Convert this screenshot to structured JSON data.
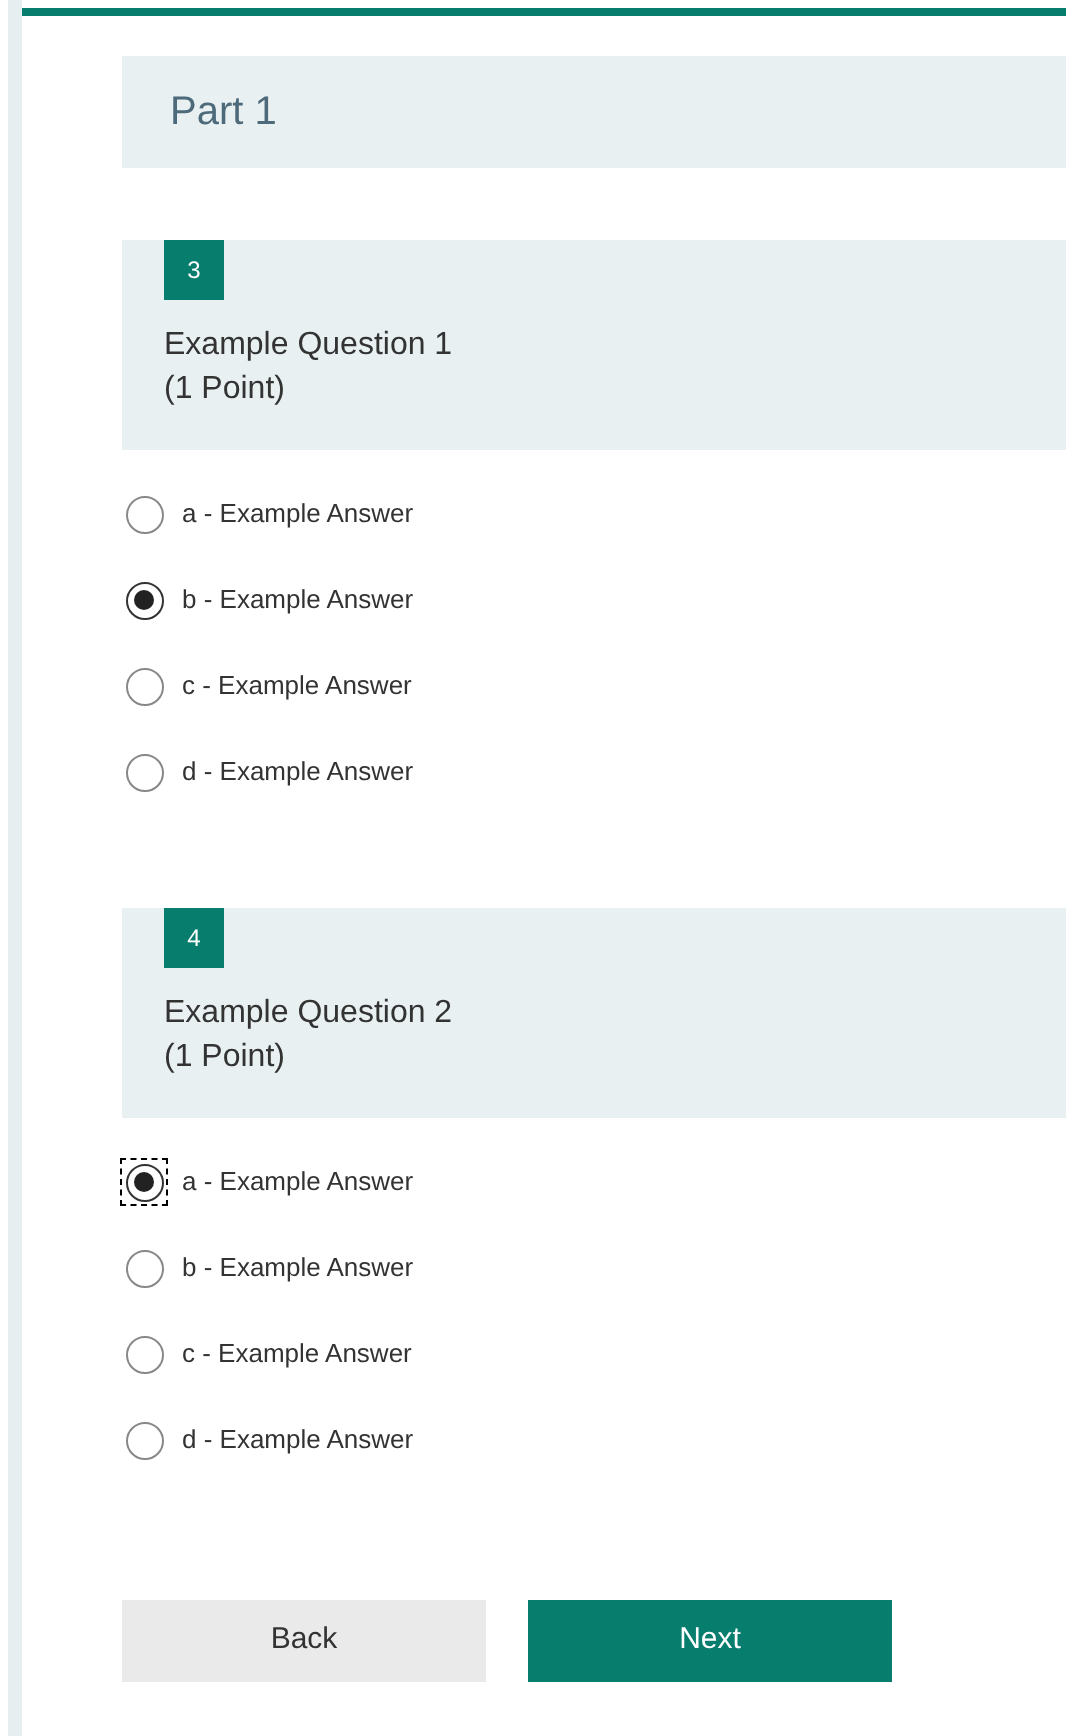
{
  "section": {
    "title": "Part 1"
  },
  "questions": [
    {
      "number": "3",
      "title": "Example Question 1",
      "points": "(1 Point)",
      "options": [
        {
          "label": "a - Example Answer",
          "selected": false,
          "focused": false
        },
        {
          "label": "b - Example Answer",
          "selected": true,
          "focused": false
        },
        {
          "label": "c - Example Answer",
          "selected": false,
          "focused": false
        },
        {
          "label": "d - Example Answer",
          "selected": false,
          "focused": false
        }
      ]
    },
    {
      "number": "4",
      "title": "Example Question 2",
      "points": "(1 Point)",
      "options": [
        {
          "label": "a - Example Answer",
          "selected": true,
          "focused": true
        },
        {
          "label": "b - Example Answer",
          "selected": false,
          "focused": false
        },
        {
          "label": "c - Example Answer",
          "selected": false,
          "focused": false
        },
        {
          "label": "d - Example Answer",
          "selected": false,
          "focused": false
        }
      ]
    }
  ],
  "buttons": {
    "back": "Back",
    "next": "Next"
  }
}
